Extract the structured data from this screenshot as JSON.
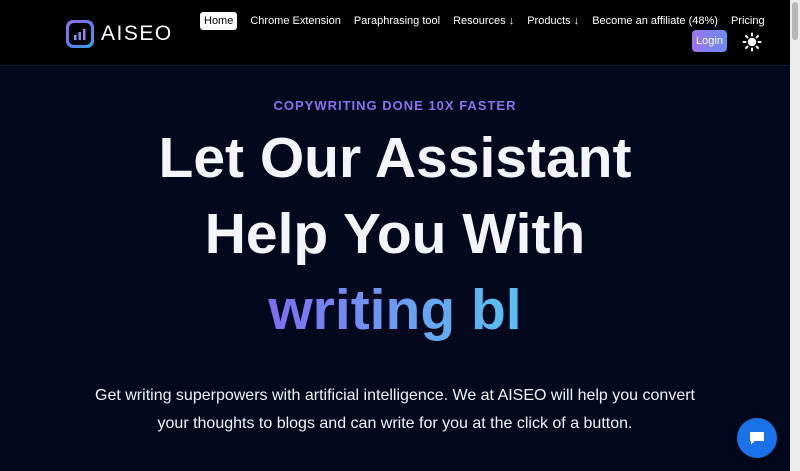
{
  "header": {
    "logo_text": "AISEO",
    "nav": [
      {
        "label": "Home"
      },
      {
        "label": "Chrome Extension"
      },
      {
        "label": "Paraphrasing tool"
      },
      {
        "label": "Resources ↓"
      },
      {
        "label": "Products ↓"
      },
      {
        "label": "Become an affiliate (48%)"
      },
      {
        "label": "Pricing"
      }
    ],
    "login_label": "Login"
  },
  "hero": {
    "eyebrow": "COPYWRITING DONE 10X FASTER",
    "headline_line1": "Let Our Assistant",
    "headline_line2": "Help You With",
    "typing_text": "writing bl",
    "subtext_line1": "Get writing superpowers with artificial intelligence. We at AISEO will help you convert",
    "subtext_line2": "your thoughts to blogs and can write for you at the click of a button."
  },
  "colors": {
    "background": "#03081c",
    "accent_purple": "#8e6ff2",
    "gradient_start": "#7d6ef0",
    "gradient_end": "#58c3f1",
    "chat_button": "#1a72e8"
  },
  "icons": {
    "logo": "chart-bars-icon",
    "theme_toggle": "sun-icon",
    "chat": "chat-bubble-icon"
  }
}
